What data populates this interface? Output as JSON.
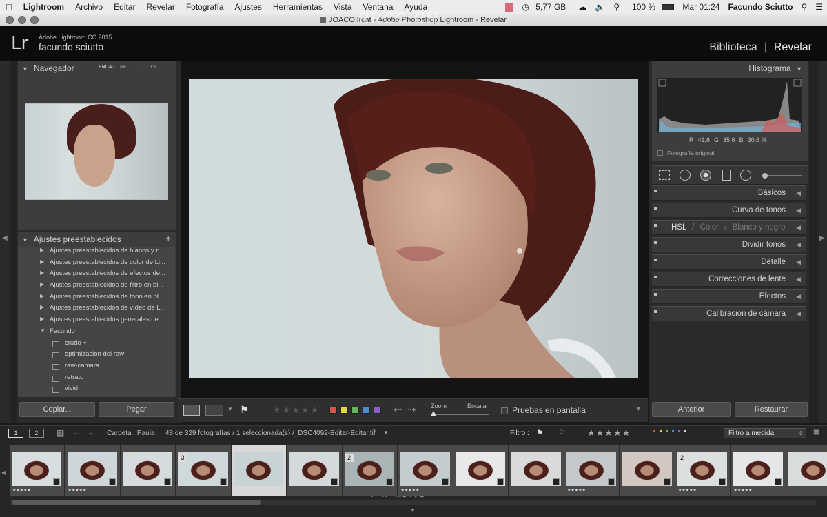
{
  "menubar": {
    "items": [
      "Lightroom",
      "Archivo",
      "Editar",
      "Revelar",
      "Fotografía",
      "Ajustes",
      "Herramientas",
      "Vista",
      "Ventana",
      "Ayuda"
    ],
    "storage": "5,77 GB",
    "battery": "100 %",
    "clock": "Mar 01:24",
    "user": "Facundo Sciutto"
  },
  "window_title": "JOACO.lrcat - Adobe Photoshop Lightroom - Revelar",
  "identity": {
    "logo": "Lr",
    "app_version": "Adobe Lightroom CC 2015",
    "user_name": "facundo sciutto",
    "module_library": "Biblioteca",
    "module_develop": "Revelar",
    "separator": "|"
  },
  "left_panel": {
    "navigator_title": "Navegador",
    "zoom_options": [
      "ENCAJ",
      "RELL",
      "1:1",
      "1:1"
    ],
    "presets_title": "Ajustes preestablecidos",
    "presets_add": "+",
    "presets": [
      {
        "label": "Ajustes preestablecidos de blanco y n...",
        "child": false,
        "open": false
      },
      {
        "label": "Ajustes preestablecidos de color de Li...",
        "child": false,
        "open": false
      },
      {
        "label": "Ajustes preestablecidos de efectos de...",
        "child": false,
        "open": false
      },
      {
        "label": "Ajustes preestablecidos de filtro en bl...",
        "child": false,
        "open": false
      },
      {
        "label": "Ajustes preestablecidos de tono en bl...",
        "child": false,
        "open": false
      },
      {
        "label": "Ajustes preestablecidos de vídeo de L...",
        "child": false,
        "open": false
      },
      {
        "label": "Ajustes preestablecidos generales de ...",
        "child": false,
        "open": false
      },
      {
        "label": "Facundo",
        "child": false,
        "open": true
      },
      {
        "label": "crudo +",
        "child": true
      },
      {
        "label": "optimizacion del raw",
        "child": true
      },
      {
        "label": "raw-camara",
        "child": true
      },
      {
        "label": "retrato",
        "child": true
      },
      {
        "label": "vivid",
        "child": true
      }
    ],
    "copy_button": "Copiar...",
    "paste_button": "Pegar"
  },
  "right_panel": {
    "histogram_title": "Histograma",
    "rgb": {
      "r_label": "R",
      "r": "41,6",
      "g_label": "G",
      "g": "35,6",
      "b_label": "B",
      "b": "30,6 %"
    },
    "original_photo": "Fotografía original",
    "sections": [
      "Básicos",
      "Curva de tonos",
      "Dividir tonos",
      "Detalle",
      "Correcciones de lente",
      "Efectos",
      "Calibración de cámara"
    ],
    "hsl_tabs": [
      "HSL",
      "/",
      "Color",
      "/",
      "Blanco y negro"
    ],
    "prev_button": "Anterior",
    "reset_button": "Restaurar"
  },
  "toolbar": {
    "zoom_label": "Zoom",
    "fit_label": "Encajar",
    "proof_label": "Pruebas en pantalla",
    "color_labels": [
      "#d9534f",
      "#e6d63a",
      "#5fb85a",
      "#4a8fd6",
      "#8a5fc7"
    ]
  },
  "filmstrip_bar": {
    "screen1": "1",
    "screen2": "2",
    "folder": "Carpeta : Paula",
    "count": "48 de 329 fotografías / 1 seleccionada(s) /_DSC4092-Editar-Editar.tif",
    "filter_label": "Filtro :",
    "filter_value": "Filtro a medida"
  },
  "filmstrip": {
    "thumbs": [
      {
        "num": "",
        "stars": "★★★★★"
      },
      {
        "num": "",
        "stars": "★★★★★"
      },
      {
        "num": "",
        "stars": ""
      },
      {
        "num": "3",
        "stars": ""
      },
      {
        "num": "",
        "stars": ""
      },
      {
        "num": "",
        "stars": ""
      },
      {
        "num": "2",
        "stars": ""
      },
      {
        "num": "",
        "stars": "★★★★★"
      },
      {
        "num": "",
        "stars": ""
      },
      {
        "num": "",
        "stars": ""
      },
      {
        "num": "",
        "stars": "★★★★★"
      },
      {
        "num": "",
        "stars": ""
      },
      {
        "num": "2",
        "stars": "★★★★★"
      },
      {
        "num": "",
        "stars": "★★★★★"
      },
      {
        "num": "",
        "stars": ""
      }
    ]
  },
  "watermark": {
    "top": "RRCG.CN",
    "bottom": "人人素材"
  }
}
